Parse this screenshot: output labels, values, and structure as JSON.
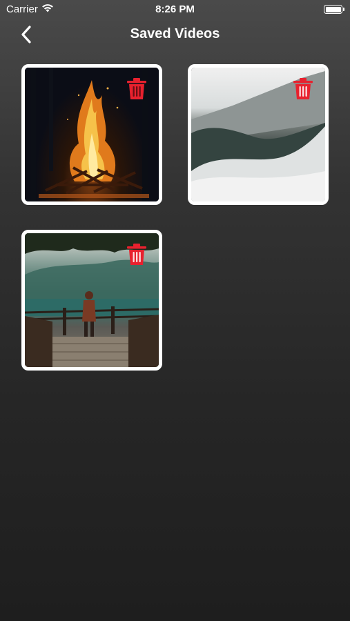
{
  "status_bar": {
    "carrier": "Carrier",
    "time": "8:26 PM",
    "icons": [
      "wifi-icon",
      "battery-icon"
    ]
  },
  "nav": {
    "title": "Saved Videos",
    "back_icon": "chevron-left-icon"
  },
  "videos": [
    {
      "scene": "campfire at night",
      "delete_icon": "trash-icon"
    },
    {
      "scene": "fog over forested mountain",
      "delete_icon": "trash-icon"
    },
    {
      "scene": "person on wooden dock by misty lake",
      "delete_icon": "trash-icon"
    }
  ],
  "colors": {
    "background_top": "#4a4a4a",
    "background_bottom": "#1e1e1e",
    "delete_red": "#e8212e",
    "thumb_border": "#ffffff"
  }
}
